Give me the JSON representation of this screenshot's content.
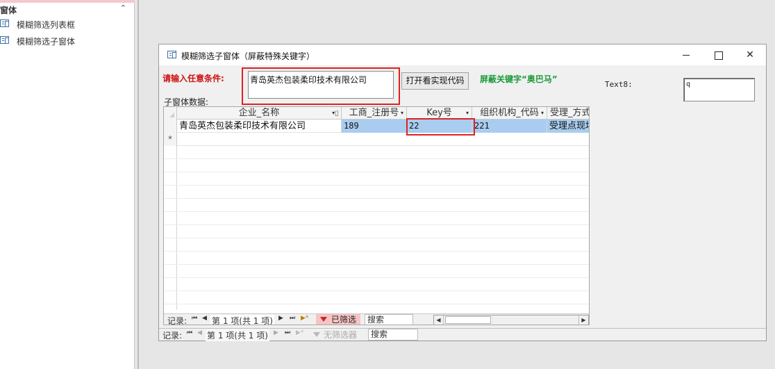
{
  "nav_pane": {
    "group_title": "窗体",
    "collapse_glyph": "⌃",
    "items": [
      {
        "label": "模糊筛选列表框"
      },
      {
        "label": "模糊筛选子窗体"
      }
    ]
  },
  "window": {
    "title": "模糊筛选子窗体（屏蔽特殊关键字）",
    "controls": {
      "minimize": "",
      "maximize": "",
      "close": "✕"
    }
  },
  "form": {
    "condition_label": "请输入任意条件:",
    "condition_value": "青岛英杰包装柔印技术有限公司",
    "open_code_button": "打开看实现代码",
    "shield_label": "屏蔽关键字“奥巴马”",
    "text8_label": "Text8:",
    "text8_value": "q",
    "subform_label": "子窗体数据:"
  },
  "grid": {
    "columns": [
      {
        "label": "企业_名称",
        "arrow": "▾⃫"
      },
      {
        "label": "工商_注册号",
        "arrow": "▾"
      },
      {
        "label": "Key号",
        "arrow": "▾"
      },
      {
        "label": "组织机构_代码",
        "arrow": "▾"
      },
      {
        "label": "受理_方式",
        "arrow": ""
      }
    ],
    "rows": [
      [
        "青岛英杰包装柔印技术有限公司",
        "189",
        "22",
        "221",
        "受理点现场"
      ]
    ],
    "new_row_marker": "*"
  },
  "subform_nav": {
    "record_label": "记录:",
    "first": "⏮",
    "prev": "◀",
    "position": "第 1 项(共 1 项)",
    "next": "▶",
    "last": "⏭",
    "new": "▶*",
    "filter_status": "已筛选",
    "search": "搜索",
    "scroll_left": "◀",
    "scroll_right": "▶"
  },
  "main_nav": {
    "record_label": "记录:",
    "first": "⏮",
    "prev": "◀",
    "position": "第 1 项(共 1 项)",
    "next": "▶",
    "last": "⏭",
    "new": "▶*",
    "filter_status": "无筛选器",
    "search": "搜索"
  },
  "colors": {
    "highlight_red": "#e02020",
    "condition_label": "#d01010",
    "shield_label": "#1c9a3a",
    "row_selected": "#a9cdf0",
    "filter_badge": "#f7c4c4"
  }
}
